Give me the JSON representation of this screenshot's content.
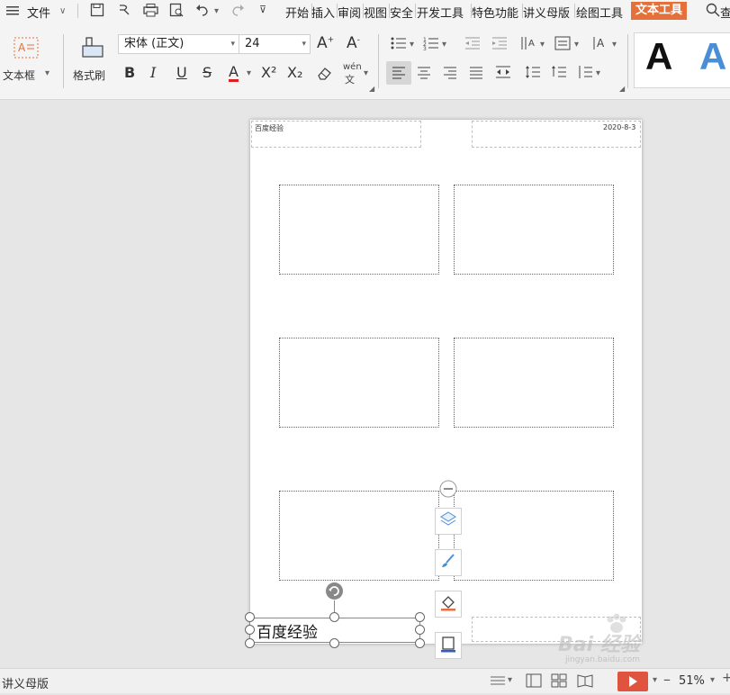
{
  "menubar": {
    "file_label": "文件",
    "tabs": [
      "开始",
      "插入",
      "审阅",
      "视图",
      "安全",
      "开发工具",
      "特色功能",
      "讲义母版",
      "绘图工具"
    ],
    "active_tab": "文本工具",
    "search_label": "查"
  },
  "ribbon": {
    "textbox_label": "文本框",
    "format_painter_label": "格式刷",
    "font_name": "宋体 (正文)",
    "font_size": "24",
    "bold": "B",
    "italic": "I",
    "underline": "U",
    "strike": "S",
    "font_color": "A",
    "superscript": "X²",
    "subscript": "X₂",
    "phonetic": "wén",
    "style_preview_1": "A",
    "style_preview_2": "A"
  },
  "page": {
    "header_left": "百度经验",
    "header_right": "2020-8-3",
    "textbox_text": "百度经验"
  },
  "statusbar": {
    "mode_label": "讲义母版",
    "zoom": "51%"
  },
  "watermark": {
    "brand": "Bai  经验",
    "url": "jingyan.baidu.com"
  },
  "colors": {
    "accent": "#e4703a",
    "play": "#e0533e",
    "style_blue": "#4a8fd6"
  }
}
